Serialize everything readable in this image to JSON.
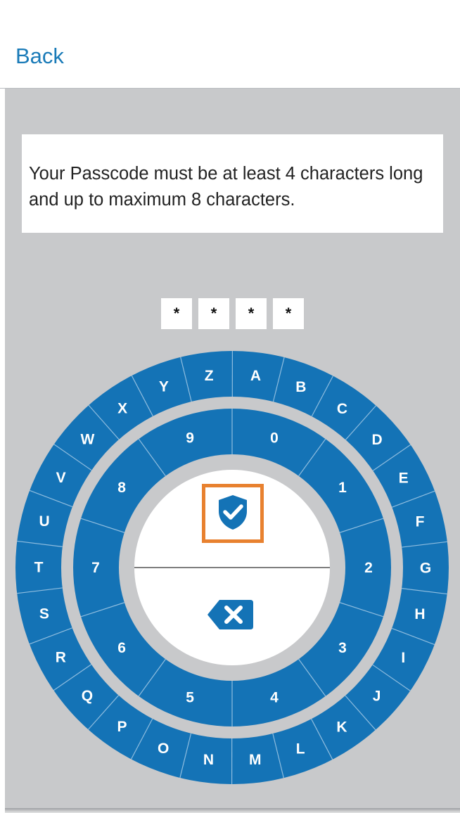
{
  "header": {
    "back_label": "Back"
  },
  "message": "Your Passcode must be at least 4 characters long and up to maximum 8 characters.",
  "pin": {
    "entered": [
      "*",
      "*",
      "*",
      "*"
    ]
  },
  "dial": {
    "letters": [
      "A",
      "B",
      "C",
      "D",
      "E",
      "F",
      "G",
      "H",
      "I",
      "J",
      "K",
      "L",
      "M",
      "N",
      "O",
      "P",
      "Q",
      "R",
      "S",
      "T",
      "U",
      "V",
      "W",
      "X",
      "Y",
      "Z"
    ],
    "digits": [
      "0",
      "1",
      "2",
      "3",
      "4",
      "5",
      "6",
      "7",
      "8",
      "9"
    ],
    "confirm_icon": "shield-check-icon",
    "delete_icon": "backspace-x-icon"
  },
  "colors": {
    "dial_blue": "#1473b6",
    "accent_link": "#1a7bb8",
    "highlight": "#e8812f",
    "background": "#c8c9cb"
  }
}
